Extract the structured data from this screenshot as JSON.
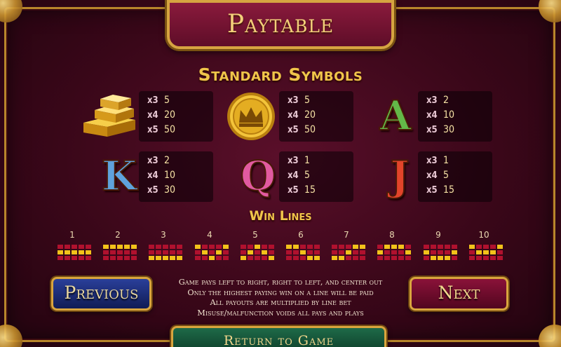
{
  "title": "Paytable",
  "standard_heading": "Standard Symbols",
  "symbols": [
    {
      "name": "gold-bars",
      "pays": [
        {
          "mult": "x3",
          "value": "5"
        },
        {
          "mult": "x4",
          "value": "20"
        },
        {
          "mult": "x5",
          "value": "50"
        }
      ]
    },
    {
      "name": "gold-coin",
      "pays": [
        {
          "mult": "x3",
          "value": "5"
        },
        {
          "mult": "x4",
          "value": "20"
        },
        {
          "mult": "x5",
          "value": "50"
        }
      ]
    },
    {
      "name": "A",
      "pays": [
        {
          "mult": "x3",
          "value": "2"
        },
        {
          "mult": "x4",
          "value": "10"
        },
        {
          "mult": "x5",
          "value": "30"
        }
      ]
    },
    {
      "name": "K",
      "pays": [
        {
          "mult": "x3",
          "value": "2"
        },
        {
          "mult": "x4",
          "value": "10"
        },
        {
          "mult": "x5",
          "value": "30"
        }
      ]
    },
    {
      "name": "Q",
      "pays": [
        {
          "mult": "x3",
          "value": "1"
        },
        {
          "mult": "x4",
          "value": "5"
        },
        {
          "mult": "x5",
          "value": "15"
        }
      ]
    },
    {
      "name": "J",
      "pays": [
        {
          "mult": "x3",
          "value": "1"
        },
        {
          "mult": "x4",
          "value": "5"
        },
        {
          "mult": "x5",
          "value": "15"
        }
      ]
    }
  ],
  "win_lines_heading": "Win Lines",
  "win_lines": [
    {
      "number": "1",
      "rows": [
        1,
        1,
        1,
        1,
        1
      ]
    },
    {
      "number": "2",
      "rows": [
        0,
        0,
        0,
        0,
        0
      ]
    },
    {
      "number": "3",
      "rows": [
        2,
        2,
        2,
        2,
        2
      ]
    },
    {
      "number": "4",
      "rows": [
        0,
        1,
        2,
        1,
        0
      ]
    },
    {
      "number": "5",
      "rows": [
        2,
        1,
        0,
        1,
        2
      ]
    },
    {
      "number": "6",
      "rows": [
        0,
        0,
        1,
        2,
        2
      ]
    },
    {
      "number": "7",
      "rows": [
        2,
        2,
        1,
        0,
        0
      ]
    },
    {
      "number": "8",
      "rows": [
        1,
        0,
        0,
        0,
        1
      ]
    },
    {
      "number": "9",
      "rows": [
        1,
        2,
        2,
        2,
        1
      ]
    },
    {
      "number": "10",
      "rows": [
        0,
        1,
        1,
        1,
        0
      ]
    }
  ],
  "rules": [
    "Game pays left to right, right to left, and center out",
    "Only the highest paying win on a line will be paid",
    "All payouts are multiplied by line bet",
    "Misuse/malfunction voids all pays and plays"
  ],
  "buttons": {
    "previous": "Previous",
    "next": "Next",
    "return_to_game": "Return to Game"
  },
  "colors": {
    "gold": "#f0c54a",
    "line_on": "#f2c21a",
    "line_off": "#b0112e",
    "background": "#3a0719"
  }
}
